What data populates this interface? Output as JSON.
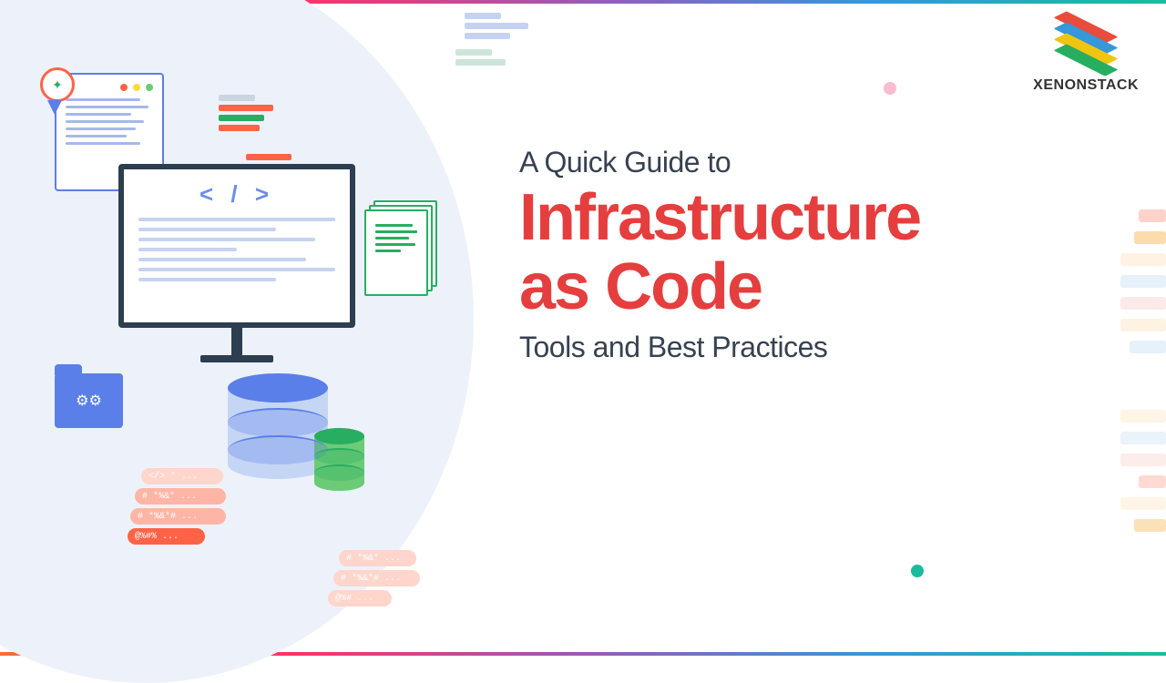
{
  "brand": {
    "name": "XENONSTACK"
  },
  "heading": {
    "subtitle": "A Quick Guide to",
    "title_line1": "Infrastructure",
    "title_line2": "as Code",
    "tagline": "Tools and Best Practices"
  },
  "illustration": {
    "code_tag": "< / >",
    "chip_texts": [
      "</> * ...",
      "# *%&* ...",
      "# *%&*# ...",
      "@%#% ..."
    ],
    "chip_texts_faded": [
      "# *%&* ...",
      "# *%&*# ...",
      "@%# ..."
    ],
    "folder_icon": "⚙⚙",
    "ribbon_icon": "✦"
  },
  "colors": {
    "accent_red": "#E53E3E",
    "text_dark": "#374151",
    "monitor_frame": "#2C3E50",
    "blue": "#5B7FE8",
    "green": "#27AE60"
  }
}
